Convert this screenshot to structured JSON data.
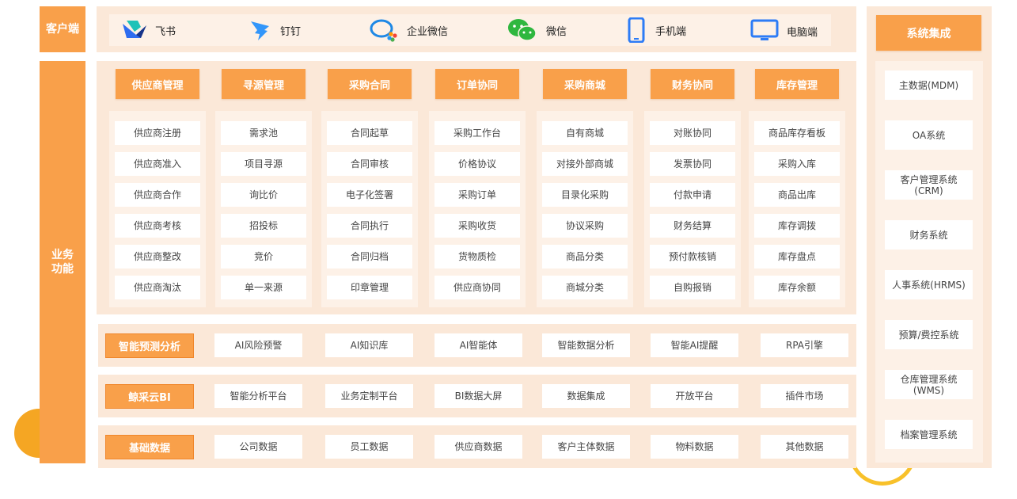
{
  "client_row": {
    "label": "客户端",
    "items": [
      {
        "name": "飞书",
        "icon": "feishu-icon"
      },
      {
        "name": "钉钉",
        "icon": "dingtalk-icon"
      },
      {
        "name": "企业微信",
        "icon": "wecom-icon"
      },
      {
        "name": "微信",
        "icon": "wechat-icon"
      },
      {
        "name": "手机端",
        "icon": "phone-icon"
      },
      {
        "name": "电脑端",
        "icon": "monitor-icon"
      }
    ]
  },
  "business": {
    "label": "业务\n功能",
    "modules": [
      {
        "title": "供应商管理",
        "items": [
          "供应商注册",
          "供应商准入",
          "供应商合作",
          "供应商考核",
          "供应商整改",
          "供应商淘汰"
        ]
      },
      {
        "title": "寻源管理",
        "items": [
          "需求池",
          "项目寻源",
          "询比价",
          "招投标",
          "竞价",
          "单一来源"
        ]
      },
      {
        "title": "采购合同",
        "items": [
          "合同起草",
          "合同审核",
          "电子化签署",
          "合同执行",
          "合同归档",
          "印章管理"
        ]
      },
      {
        "title": "订单协同",
        "items": [
          "采购工作台",
          "价格协议",
          "采购订单",
          "采购收货",
          "货物质检",
          "供应商协同"
        ]
      },
      {
        "title": "采购商城",
        "items": [
          "自有商城",
          "对接外部商城",
          "目录化采购",
          "协议采购",
          "商品分类",
          "商城分类"
        ]
      },
      {
        "title": "财务协同",
        "items": [
          "对账协同",
          "发票协同",
          "付款申请",
          "财务结算",
          "预付款核销",
          "自购报销"
        ]
      },
      {
        "title": "库存管理",
        "items": [
          "商品库存看板",
          "采购入库",
          "商品出库",
          "库存调拨",
          "库存盘点",
          "库存余额"
        ]
      }
    ],
    "rows": [
      {
        "title": "智能预测分析",
        "items": [
          "AI风险预警",
          "AI知识库",
          "AI智能体",
          "智能数据分析",
          "智能AI提醒",
          "RPA引擎"
        ]
      },
      {
        "title": "鲸采云BI",
        "items": [
          "智能分析平台",
          "业务定制平台",
          "BI数据大屏",
          "数据集成",
          "开放平台",
          "插件市场"
        ]
      },
      {
        "title": "基础数据",
        "items": [
          "公司数据",
          "员工数据",
          "供应商数据",
          "客户主体数据",
          "物料数据",
          "其他数据"
        ]
      }
    ]
  },
  "integration": {
    "title": "系统集成",
    "items": [
      "主数据(MDM)",
      "OA系统",
      "客户管理系统\n(CRM)",
      "财务系统",
      "人事系统(HRMS)",
      "预算/费控系统",
      "仓库管理系统\n(WMS)",
      "档案管理系统"
    ]
  },
  "colors": {
    "accent": "#f9a04a",
    "panel": "#fbe8d8",
    "inner": "#fdf1e7"
  }
}
